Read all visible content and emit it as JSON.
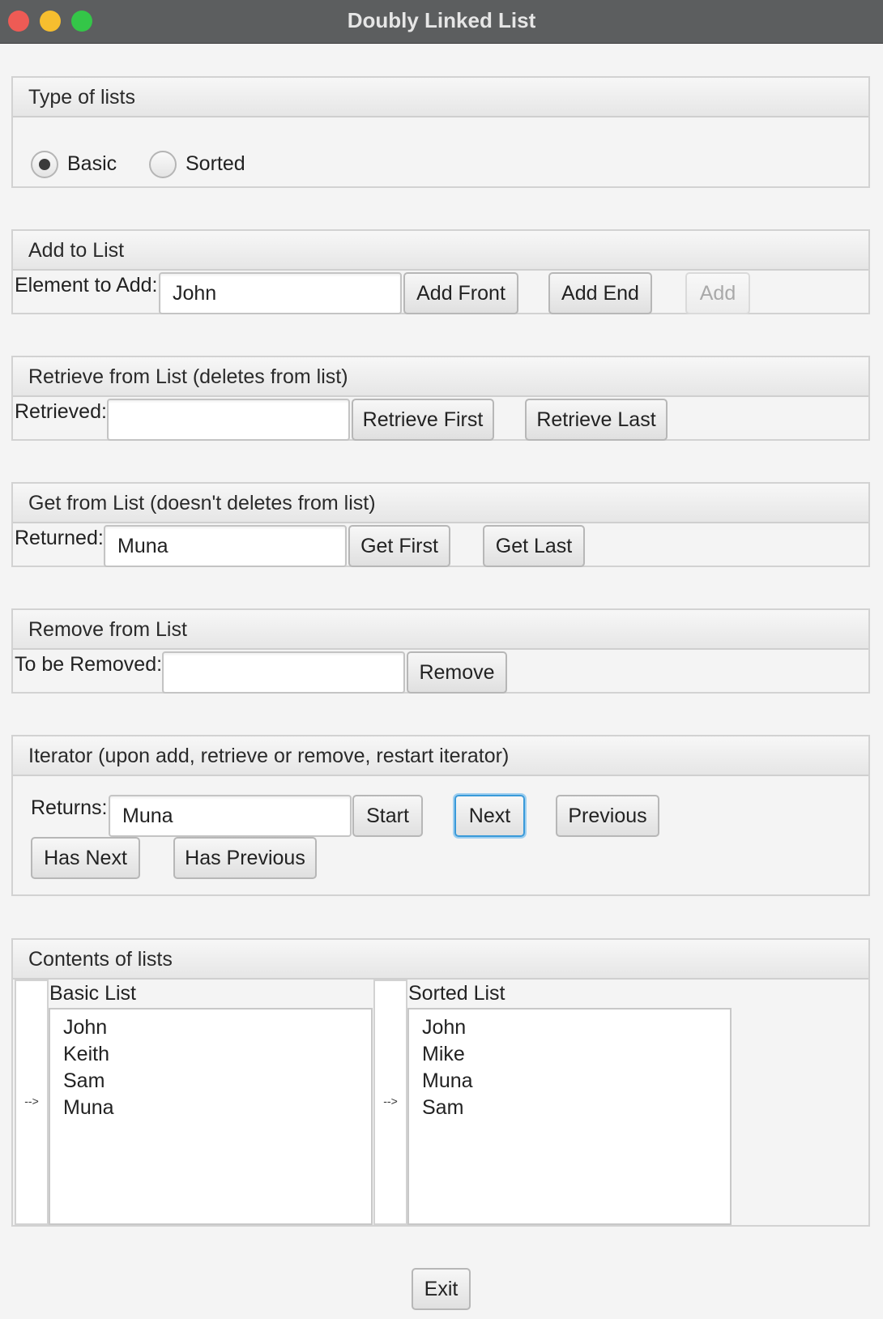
{
  "window": {
    "title": "Doubly Linked List"
  },
  "type_panel": {
    "title": "Type of lists",
    "radio_basic": "Basic",
    "radio_sorted": "Sorted",
    "selected": "Basic"
  },
  "add_panel": {
    "title": "Add to List",
    "label": "Element to Add:",
    "input_value": "John",
    "add_front": "Add Front",
    "add_end": "Add End",
    "add": "Add"
  },
  "retrieve_panel": {
    "title": "Retrieve from List (deletes from list)",
    "label": "Retrieved:",
    "input_value": "",
    "retrieve_first": "Retrieve First",
    "retrieve_last": "Retrieve Last"
  },
  "get_panel": {
    "title": "Get from List (doesn't deletes from list)",
    "label": "Returned:",
    "input_value": "Muna",
    "get_first": "Get First",
    "get_last": "Get Last"
  },
  "remove_panel": {
    "title": "Remove from List",
    "label": "To be Removed:",
    "input_value": "",
    "remove": "Remove"
  },
  "iterator_panel": {
    "title": "Iterator (upon add, retrieve or remove, restart iterator)",
    "label": "Returns:",
    "input_value": "Muna",
    "start": "Start",
    "next": "Next",
    "previous": "Previous",
    "has_next": "Has Next",
    "has_previous": "Has Previous"
  },
  "contents_panel": {
    "title": "Contents of lists",
    "arrow": "-->",
    "basic_title": "Basic List",
    "basic_items": [
      "John",
      "Keith",
      "Sam",
      "Muna"
    ],
    "sorted_title": "Sorted List",
    "sorted_items": [
      "John",
      "Mike",
      "Muna",
      "Sam"
    ]
  },
  "footer": {
    "exit": "Exit"
  }
}
